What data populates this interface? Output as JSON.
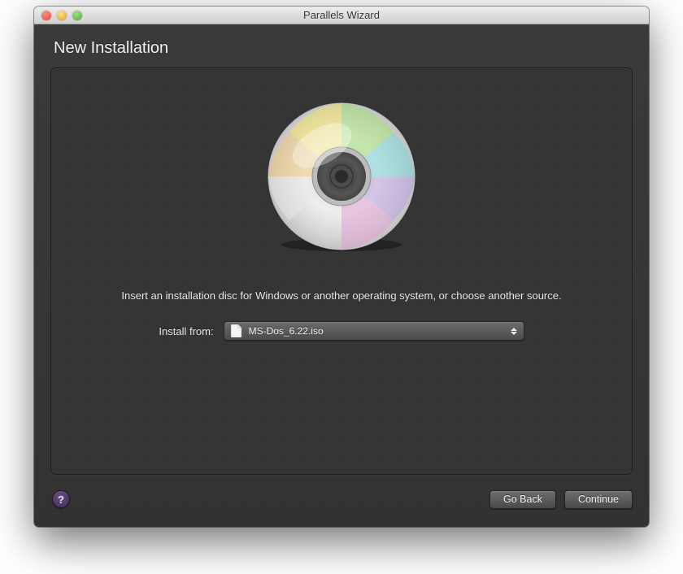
{
  "window": {
    "title": "Parallels Wizard"
  },
  "page": {
    "heading": "New Installation",
    "instruction": "Insert an installation disc for Windows or another operating system, or choose another source.",
    "source_label": "Install from:",
    "selected_source": "MS-Dos_6.22.iso"
  },
  "footer": {
    "help_glyph": "?",
    "back_label": "Go Back",
    "continue_label": "Continue"
  },
  "icons": {
    "cd": "cd-disc-icon",
    "file": "file-icon",
    "updown": "updown-arrows-icon"
  }
}
